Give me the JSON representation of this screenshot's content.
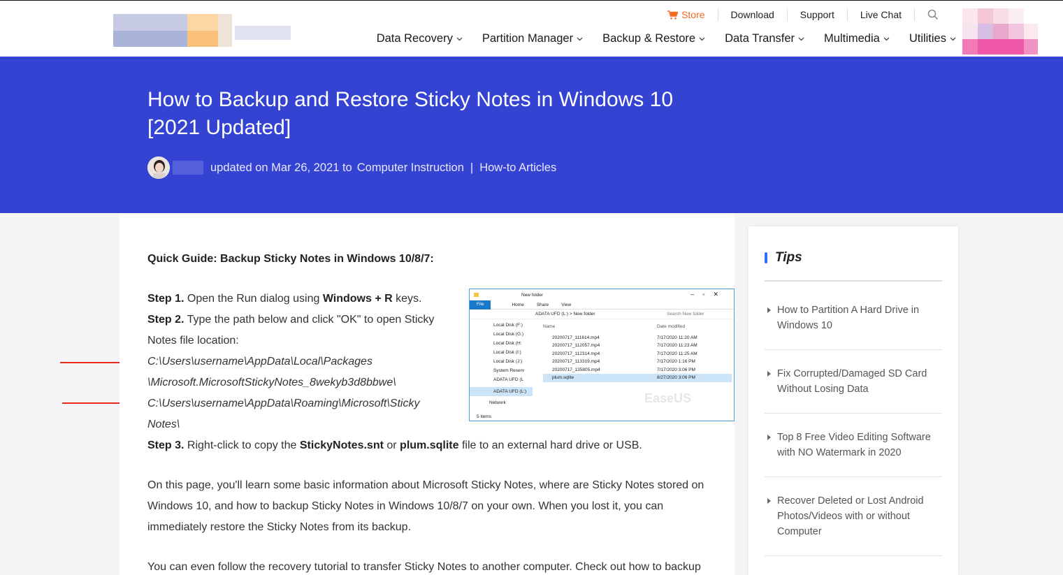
{
  "header": {
    "top_nav": [
      "Store",
      "Download",
      "Support",
      "Live Chat"
    ],
    "main_nav": [
      "Data Recovery",
      "Partition Manager",
      "Backup & Restore",
      "Data Transfer",
      "Multimedia",
      "Utilities"
    ]
  },
  "hero": {
    "title": "How to Backup and Restore Sticky Notes in Windows 10 [2021 Updated]",
    "updated_text": "updated on Mar 26, 2021 to",
    "category_1": "Computer Instruction",
    "separator": "|",
    "category_2": "How-to Articles"
  },
  "article": {
    "quick_guide": "Quick Guide: Backup Sticky Notes in Windows 10/8/7:",
    "step1_label": "Step 1.",
    "step1_text": " Open the Run dialog using ",
    "step1_keys": "Windows + R",
    "step1_end": " keys.",
    "step2_label": "Step 2.",
    "step2_text_line1": " Type the path below and click \"OK\" to open Sticky",
    "step2_text_line2": "Notes file location:",
    "path1_line1": "C:\\Users\\username\\AppData\\Local\\Packages",
    "path1_line2": "\\Microsoft.MicrosoftStickyNotes_8wekyb3d8bbwe\\",
    "path2_line1": "C:\\Users\\username\\AppData\\Roaming\\Microsoft\\Sticky",
    "path2_line2": "Notes\\",
    "step3_label": "Step 3.",
    "step3_text": " Right-click to copy the ",
    "step3_file1": "StickyNotes.snt",
    "step3_or": " or ",
    "step3_file2": "plum.sqlite",
    "step3_end": " file to an external hard drive or USB.",
    "para1": "On this page, you'll learn some basic information about Microsoft Sticky Notes, where are Sticky Notes stored on Windows 10, and how to backup Sticky Notes in Windows 10/8/7 on your own. When you lost it, you can immediately restore the Sticky Notes from its backup.",
    "para2": "You can even follow the recovery tutorial to transfer Sticky Notes to another computer. Check out how to backup"
  },
  "explorer": {
    "title": "New folder",
    "ribbon": [
      "File",
      "Home",
      "Share",
      "View"
    ],
    "address": "ADATA UFD (L:)  >  New folder",
    "search_placeholder": "Search New folder",
    "drives": [
      "Local Disk (F:)",
      "Local Disk (G:)",
      "Local Disk (H:",
      "Local Disk (I:)",
      "Local Disk (J:)",
      "System Reserv",
      "ADATA UFD (L",
      "",
      "ADATA UFD (L:)",
      "",
      "Network"
    ],
    "col_name": "Name",
    "col_date": "Date modified",
    "files": [
      {
        "name": "20200717_111614.mp4",
        "date": "7/17/2020 11:20 AM"
      },
      {
        "name": "20200717_112057.mp4",
        "date": "7/17/2020 11:23 AM"
      },
      {
        "name": "20200717_112314.mp4",
        "date": "7/17/2020 11:25 AM"
      },
      {
        "name": "20200717_113319.mp4",
        "date": "7/17/2020 1:16 PM"
      },
      {
        "name": "20200717_135805.mp4",
        "date": "7/17/2020 3:06 PM"
      },
      {
        "name": "plum.sqlite",
        "date": "8/27/2020 3:06 PM"
      }
    ],
    "status": "5 items",
    "watermark": "EaseUS"
  },
  "sidebar": {
    "title": "Tips",
    "tips": [
      [
        "How to Partition A Hard Drive in",
        "Windows 10"
      ],
      [
        "Fix Corrupted/Damaged SD Card",
        "Without Losing Data"
      ],
      [
        "Top 8 Free Video Editing Software",
        "with NO Watermark in 2020"
      ],
      [
        "Recover Deleted or Lost Android",
        "Photos/Videos with or without",
        "Computer"
      ]
    ]
  },
  "colors": {
    "hero_bg": "#3443d1",
    "store_orange": "#f36c21",
    "arrow_red": "#e8291c",
    "tips_accent": "#2f6bff"
  }
}
